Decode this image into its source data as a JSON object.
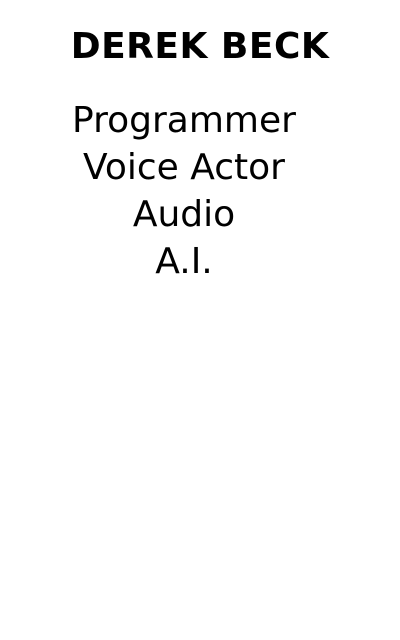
{
  "profile": {
    "name": "DEREK BECK",
    "roles": [
      {
        "label": "Programmer"
      },
      {
        "label": "Voice Actor"
      },
      {
        "label": "Audio"
      },
      {
        "label": "A.I."
      }
    ]
  },
  "colors": {
    "background": "#ffffff",
    "text": "#000000"
  }
}
